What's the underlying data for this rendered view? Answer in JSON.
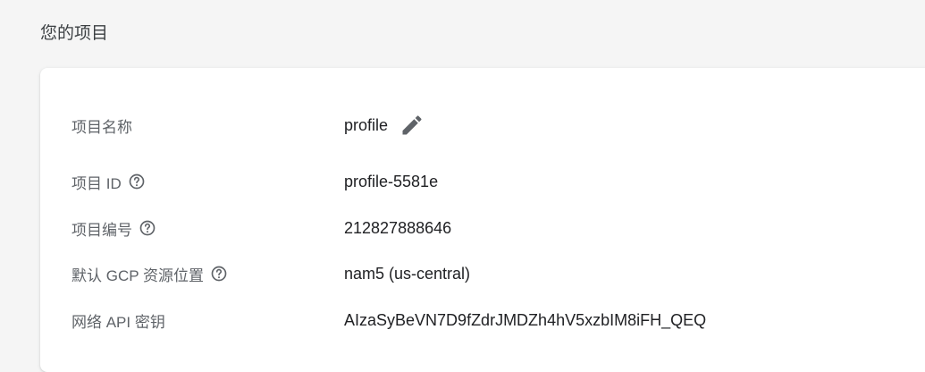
{
  "section_title": "您的项目",
  "colors": {
    "page_background": "#f5f5f5",
    "card_background": "#ffffff",
    "label_text": "#5f6368",
    "value_text": "#202124",
    "icon": "#5f6368"
  },
  "fields": [
    {
      "label": "项目名称",
      "value": "profile",
      "help_icon": false,
      "edit_icon": "pencil-icon"
    },
    {
      "label": "项目 ID",
      "value": "profile-5581e",
      "help_icon": "help-circle-icon"
    },
    {
      "label": "项目编号",
      "value": "212827888646",
      "help_icon": "help-circle-icon"
    },
    {
      "label": "默认 GCP 资源位置",
      "value": "nam5 (us-central)",
      "help_icon": "help-circle-icon"
    },
    {
      "label": "网络 API 密钥",
      "value": "AIzaSyBeVN7D9fZdrJMDZh4hV5xzbIM8iFH_QEQ",
      "help_icon": false
    }
  ]
}
